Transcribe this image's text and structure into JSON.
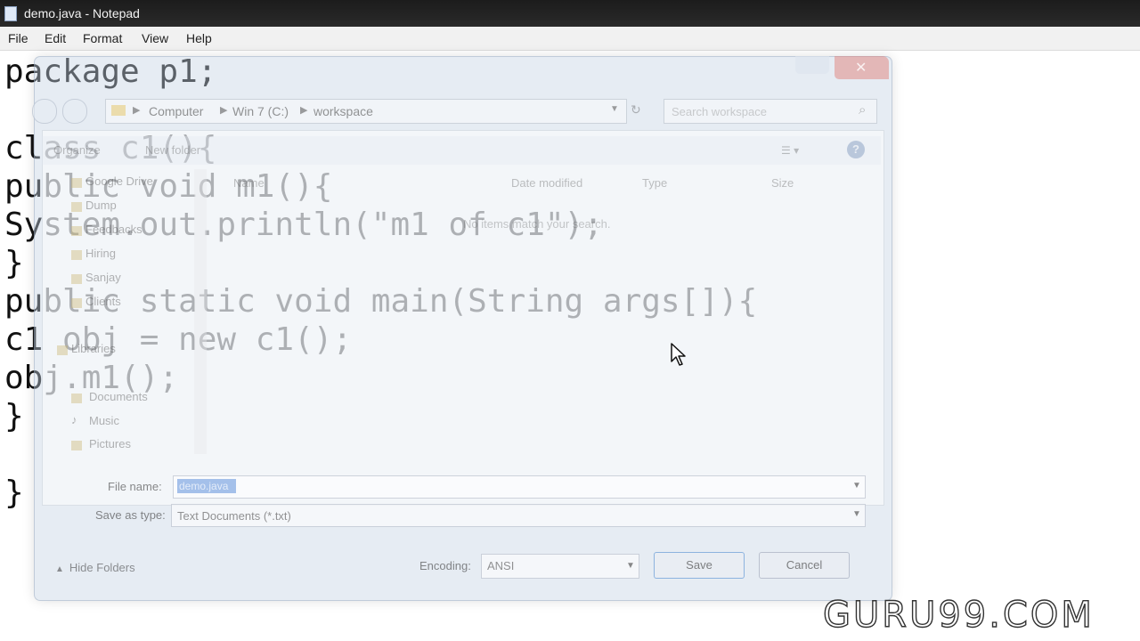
{
  "window": {
    "title": "demo.java - Notepad",
    "icon": "notepad-icon"
  },
  "menu": [
    "File",
    "Edit",
    "Format",
    "View",
    "Help"
  ],
  "code_lines": [
    "package p1;",
    "",
    "class c1(){",
    "public void m1(){",
    "System.out.println(\"m1 of c1\");",
    "}",
    "public static void main(String args[]){",
    "c1 obj = new c1();",
    "obj.m1();",
    "}",
    "",
    "}"
  ],
  "dialog": {
    "address": [
      "Computer",
      "Win 7 (C:)",
      "workspace"
    ],
    "search_placeholder": "Search workspace",
    "toolbar": {
      "organize": "Organize",
      "new_folder": "New folder"
    },
    "columns": [
      "Name",
      "Date modified",
      "Type",
      "Size"
    ],
    "empty_message": "No items match your search.",
    "nav_items": [
      "Google Drive",
      "Dump",
      "Feedbacks",
      "Hiring",
      "Sanjay",
      "Clients",
      "Libraries",
      "Documents",
      "Music",
      "Pictures"
    ],
    "file_name_label": "File name:",
    "file_name_value": "demo.java",
    "save_type_label": "Save as type:",
    "save_type_value": "Text Documents (*.txt)",
    "encoding_label": "Encoding:",
    "encoding_value": "ANSI",
    "save_button": "Save",
    "cancel_button": "Cancel",
    "hide_folders": "Hide Folders"
  },
  "watermark": "GURU99.COM"
}
